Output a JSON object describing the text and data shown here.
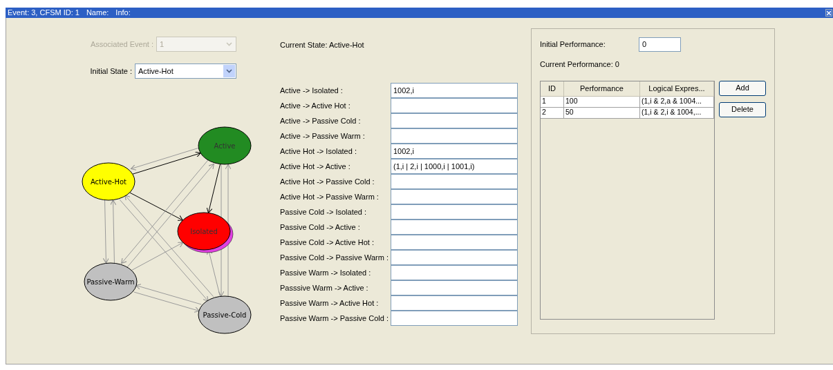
{
  "title_bar": {
    "parts": [
      "Event: 3, CFSM ID: 1",
      "Name:",
      "Info:"
    ]
  },
  "associated_event": {
    "label": "Associated Event :",
    "value": "1",
    "disabled": true
  },
  "initial_state": {
    "label": "Initial State :",
    "value": "Active-Hot",
    "disabled": false
  },
  "current_state": "Current State: Active-Hot",
  "diagram": {
    "nodes": [
      {
        "label": "Active",
        "color": "#228b22"
      },
      {
        "label": "Active-Hot",
        "color": "#ffff00"
      },
      {
        "label": "Isolated",
        "color": "#ff0000",
        "shadow": {
          "color": "#e040e0"
        }
      },
      {
        "label": "Passive-Warm",
        "color": "#c0c0c0"
      },
      {
        "label": "Passive-Cold",
        "color": "#c0c0c0"
      }
    ]
  },
  "transitions": [
    {
      "label": "Active -> Isolated :",
      "value": "1002,i"
    },
    {
      "label": "Active -> Active Hot :"
    },
    {
      "label": "Active -> Passive Cold :"
    },
    {
      "label": "Active -> Passive Warm :"
    },
    {
      "label": "Active Hot -> Isolated :",
      "value": "1002,i"
    },
    {
      "label": "Active Hot -> Active :",
      "value": "(1,i | 2,i | 1000,i | 1001,i)"
    },
    {
      "label": "Active Hot -> Passive Cold :"
    },
    {
      "label": "Active Hot -> Passive Warm :"
    },
    {
      "label": "Passive Cold -> Isolated :"
    },
    {
      "label": "Passive Cold -> Active :"
    },
    {
      "label": "Passive Cold -> Active Hot :"
    },
    {
      "label": "Passive Cold -> Passive Warm :"
    },
    {
      "label": "Passive Warm -> Isolated :"
    },
    {
      "label": "Passsive Warm -> Active :"
    },
    {
      "label": "Passive Warm -> Active Hot :"
    },
    {
      "label": "Passive Warm -> Passive Cold :"
    }
  ],
  "initial_performance": {
    "label": "Initial Performance:",
    "value": "0"
  },
  "current_performance": "Current Performance: 0",
  "performance_table": {
    "columns": [
      "ID",
      "Performance",
      "Logical Expres..."
    ],
    "rows": [
      [
        "1",
        "100",
        "(1,i & 2,a & 1004..."
      ],
      [
        "2",
        "50",
        "(1,i & 2,i & 1004,..."
      ]
    ]
  },
  "buttons": [
    "Add",
    "Delete"
  ]
}
